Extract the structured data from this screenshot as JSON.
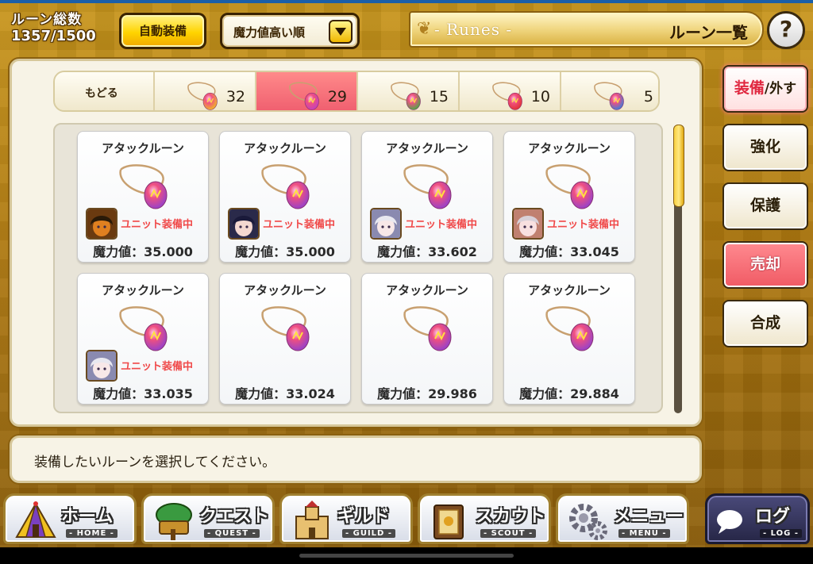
{
  "header": {
    "rune_count_label": "ルーン総数",
    "rune_count_value": "1357/1500",
    "auto_equip_label": "自動装備",
    "sort_selected": "魔力値高い順",
    "title_en": "- Runes -",
    "title_jp": "ルーン一覧",
    "help_label": "?"
  },
  "tabs": [
    {
      "label": "もどる"
    },
    {
      "count": "32",
      "gem_color": "#f0c020"
    },
    {
      "count": "29",
      "gem_color": "#c040c0",
      "active": true
    },
    {
      "count": "15",
      "gem_color": "#40b040"
    },
    {
      "count": "10",
      "gem_color": "#e03030"
    },
    {
      "count": "5",
      "gem_color": "#3080e0"
    }
  ],
  "runes": [
    {
      "name": "アタックルーン",
      "equipped": "ユニット装備中",
      "power": "魔力値：35.000",
      "avatar": "pumpkin"
    },
    {
      "name": "アタックルーン",
      "equipped": "ユニット装備中",
      "power": "魔力値：35.000",
      "avatar": "dark-hair"
    },
    {
      "name": "アタックルーン",
      "equipped": "ユニット装備中",
      "power": "魔力値：33.602",
      "avatar": "white-hair"
    },
    {
      "name": "アタックルーン",
      "equipped": "ユニット装備中",
      "power": "魔力値：33.045",
      "avatar": "silver-hair"
    },
    {
      "name": "アタックルーン",
      "equipped": "ユニット装備中",
      "power": "魔力値：33.035",
      "avatar": "white-hair"
    },
    {
      "name": "アタックルーン",
      "equipped": "",
      "power": "魔力値：33.024",
      "avatar": ""
    },
    {
      "name": "アタックルーン",
      "equipped": "",
      "power": "魔力値：29.986",
      "avatar": ""
    },
    {
      "name": "アタックルーン",
      "equipped": "",
      "power": "魔力値：29.884",
      "avatar": ""
    }
  ],
  "message": "装備したいルーンを選択してください。",
  "side_buttons": {
    "equip_a": "装備",
    "equip_b": "/外す",
    "enhance": "強化",
    "protect": "保護",
    "sell": "売却",
    "combine": "合成"
  },
  "nav": [
    {
      "jp": "ホーム",
      "en": "- HOME -",
      "icon": "home-tent-icon"
    },
    {
      "jp": "クエスト",
      "en": "- QUEST -",
      "icon": "quest-map-icon"
    },
    {
      "jp": "ギルド",
      "en": "- GUILD -",
      "icon": "guild-castle-icon"
    },
    {
      "jp": "スカウト",
      "en": "- SCOUT -",
      "icon": "scout-book-icon"
    },
    {
      "jp": "メニュー",
      "en": "- MENU -",
      "icon": "menu-gear-icon"
    },
    {
      "jp": "ログ",
      "en": "- LOG -",
      "icon": "chat-bubble-icon"
    }
  ],
  "colors": {
    "accent_red": "#f04848",
    "gold": "#f0c020",
    "panel": "#f7f3e6"
  }
}
